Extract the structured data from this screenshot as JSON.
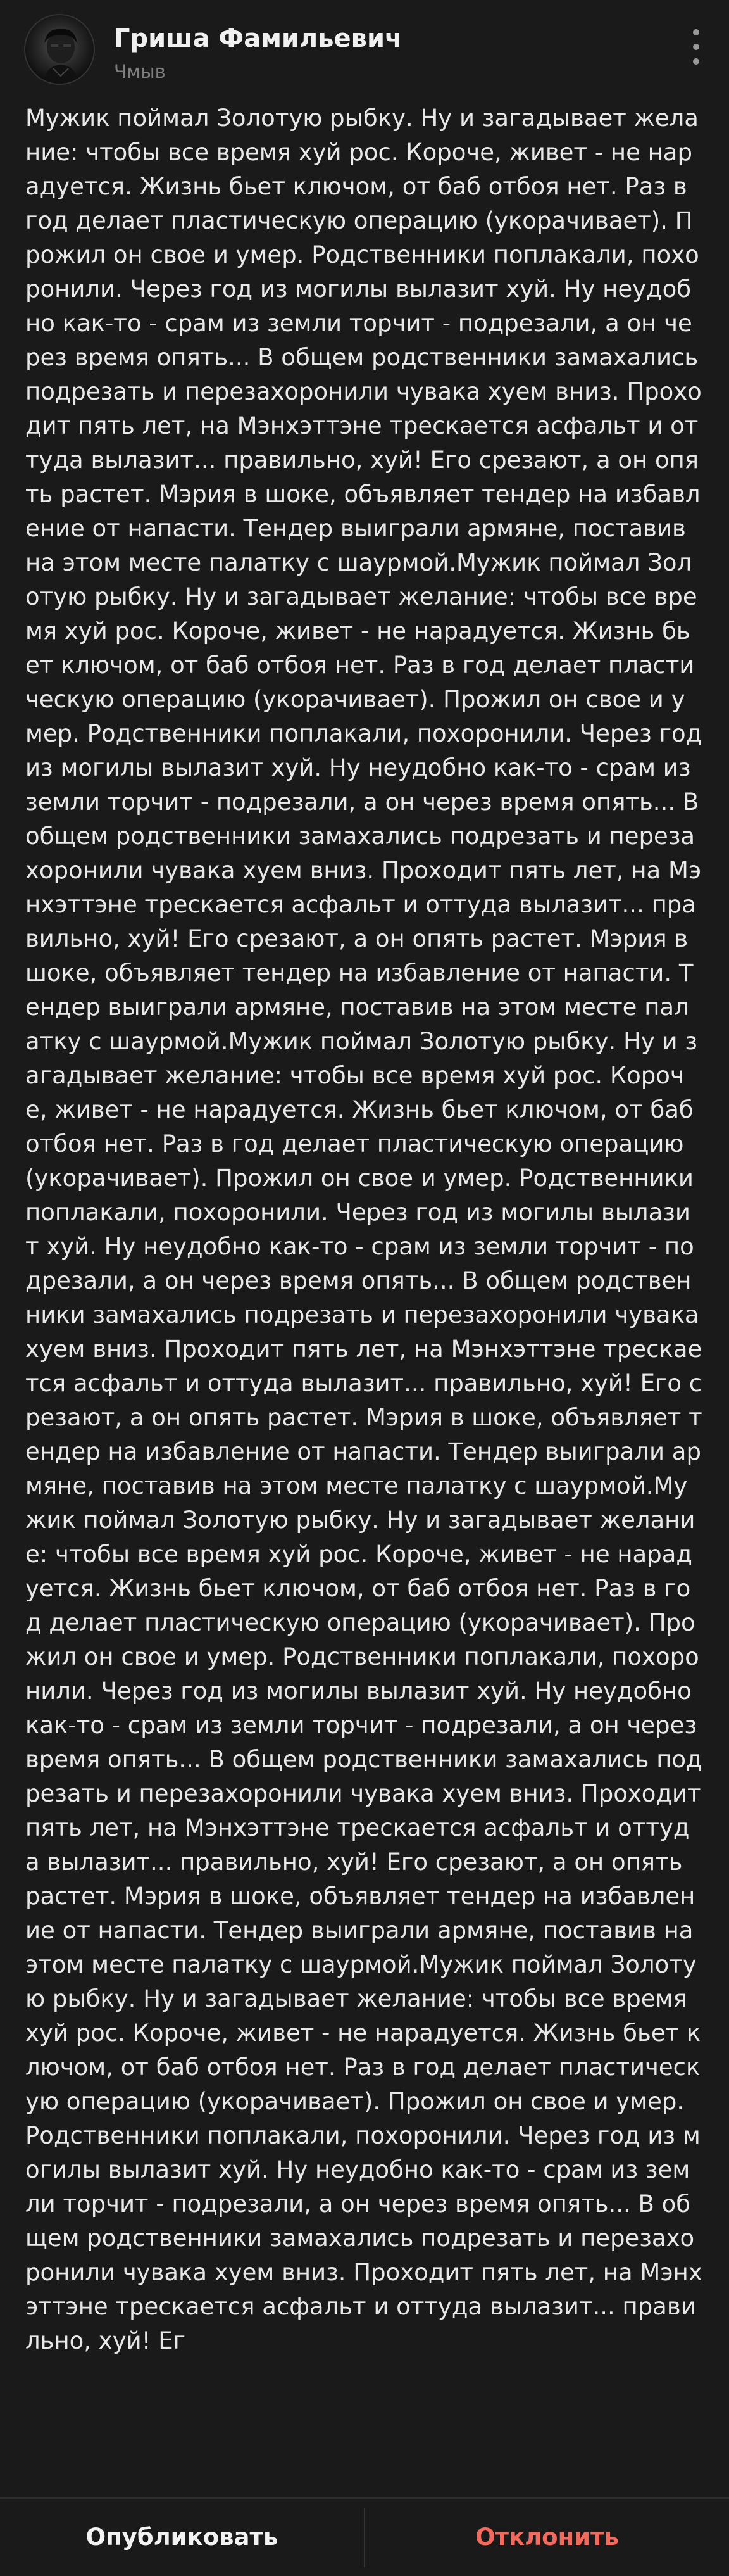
{
  "header": {
    "author_name": "Гриша Фамильевич",
    "author_subtitle": "Чмыв",
    "avatar_icon": "avatar-image",
    "more_icon": "more-vertical-icon"
  },
  "post": {
    "text": "Мужик поймал Золотую рыбку. Ну и загадывает желание: чтобы все время хуй рос. Короче, живет - не нарадуется. Жизнь бьет ключом, от баб отбоя нет. Раз в год делает пластическую операцию (укорачивает). Прожил он свое и умер. Родственники поплакали, похоронили. Через год из могилы вылазит хуй. Ну неудобно как-то - срам из земли торчит - подрезали, а он через время опять... В общем родственники замахались подрезать и перезахоронили чувака хуем вниз. Проходит пять лет, на Мэнхэттэне трескается асфальт и оттуда вылазит... правильно, хуй! Его срезают, а он опять растет. Мэрия в шоке, объявляет тендер на избавление от напасти. Тендер выиграли армяне, поставив на этом месте палатку с шаурмой.Мужик поймал Золотую рыбку. Ну и загадывает желание: чтобы все время хуй рос. Короче, живет - не нарадуется. Жизнь бьет ключом, от баб отбоя нет. Раз в год делает пластическую операцию (укорачивает). Прожил он свое и умер. Родственники поплакали, похоронили. Через год из могилы вылазит хуй. Ну неудобно как-то - срам из земли торчит - подрезали, а он через время опять... В общем родственники замахались подрезать и перезахоронили чувака хуем вниз. Проходит пять лет, на Мэнхэттэне трескается асфальт и оттуда вылазит... правильно, хуй! Его срезают, а он опять растет. Мэрия в шоке, объявляет тендер на избавление от напасти. Тендер выиграли армяне, поставив на этом месте палатку с шаурмой.Мужик поймал Золотую рыбку. Ну и загадывает желание: чтобы все время хуй рос. Короче, живет - не нарадуется. Жизнь бьет ключом, от баб отбоя нет. Раз в год делает пластическую операцию (укорачивает). Прожил он свое и умер. Родственники поплакали, похоронили. Через год из могилы вылазит хуй. Ну неудобно как-то - срам из земли торчит - подрезали, а он через время опять... В общем родственники замахались подрезать и перезахоронили чувака хуем вниз. Проходит пять лет, на Мэнхэттэне трескается асфальт и оттуда вылазит... правильно, хуй! Его срезают, а он опять растет. Мэрия в шоке, объявляет тендер на избавление от напасти. Тендер выиграли армяне, поставив на этом месте палатку с шаурмой.Мужик поймал Золотую рыбку. Ну и загадывает желание: чтобы все время хуй рос. Короче, живет - не нарадуется. Жизнь бьет ключом, от баб отбоя нет. Раз в год делает пластическую операцию (укорачивает). Прожил он свое и умер. Родственники поплакали, похоронили. Через год из могилы вылазит хуй. Ну неудобно как-то - срам из земли торчит - подрезали, а он через время опять... В общем родственники замахались подрезать и перезахоронили чувака хуем вниз. Проходит пять лет, на Мэнхэттэне трескается асфальт и оттуда вылазит... правильно, хуй! Его срезают, а он опять растет. Мэрия в шоке, объявляет тендер на избавление от напасти. Тендер выиграли армяне, поставив на этом месте палатку с шаурмой.Мужик поймал Золотую рыбку. Ну и загадывает желание: чтобы все время хуй рос. Короче, живет - не нарадуется. Жизнь бьет ключом, от баб отбоя нет. Раз в год делает пластическую операцию (укорачивает). Прожил он свое и умер. Родственники поплакали, похоронили. Через год из могилы вылазит хуй. Ну неудобно как-то - срам из земли торчит - подрезали, а он через время опять... В общем родственники замахались подрезать и перезахоронили чувака хуем вниз. Проходит пять лет, на Мэнхэттэне трескается асфальт и оттуда вылазит... правильно, хуй! Ег"
  },
  "footer": {
    "publish_label": "Опубликовать",
    "reject_label": "Отклонить"
  },
  "colors": {
    "background": "#1a1a1a",
    "text": "#e8e8e8",
    "subtitle": "#7e7e7e",
    "reject": "#f36a5c"
  }
}
